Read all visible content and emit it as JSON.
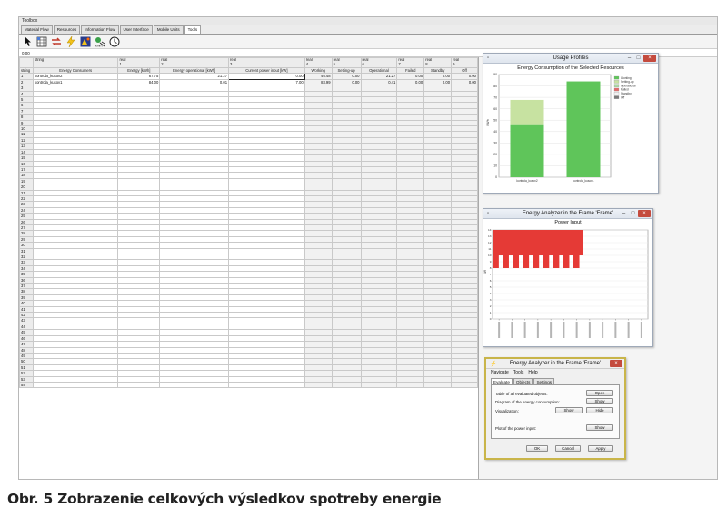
{
  "window": {
    "title": "Toolbox",
    "tabs": [
      "Material Flow",
      "Resources",
      "Information Flow",
      "User Interface",
      "Mobile Units",
      "Tools"
    ],
    "active_tab": 5
  },
  "toolbar": {
    "icons": [
      "pointer-icon",
      "sheet-icon",
      "exchange-icon",
      "lightning-icon",
      "analyzer-icon",
      "energy-icon",
      "clock-icon"
    ]
  },
  "sheet": {
    "cell_ref": "0.00",
    "type_row": [
      "",
      "string",
      "real\n1",
      "real\n2",
      "real\n3",
      "real\n4",
      "real\n5",
      "real\n6",
      "real\n7",
      "real\n8",
      "real\n9"
    ],
    "header_row": [
      "string",
      "Energy Consumers",
      "Energy [kWh]",
      "Energy operational [kWh]",
      "Current power input [kW]",
      "Working",
      "Setting-up",
      "Operational",
      "Failed",
      "Standby",
      "Off"
    ],
    "rows": [
      [
        "1",
        "kontrola_kusov2",
        "67.75",
        "21.27",
        "0.00",
        "46.48",
        "0.00",
        "21.27",
        "0.00",
        "0.00",
        "0.00"
      ],
      [
        "2",
        "kontrola_kusov1",
        "84.00",
        "0.01",
        "7.00",
        "83.99",
        "0.00",
        "0.41",
        "0.00",
        "0.00",
        "0.00"
      ]
    ],
    "row_count": 54
  },
  "usage_profiles": {
    "window_title": "Usage Profiles",
    "chart_title": "Energy Consumption of the Selected Resources"
  },
  "power_window": {
    "window_title": "Energy Analyzer in the Frame 'Frame'",
    "chart_title": "Power Input"
  },
  "analyzer_panel": {
    "window_title": "Energy Analyzer in the Frame 'Frame'",
    "menu": [
      "Navigate",
      "Tools",
      "Help"
    ],
    "tabs": [
      "Evaluate",
      "Objects",
      "Settings"
    ],
    "rows": {
      "table_label": "Table of all evaluated objects:",
      "diagram_label": "Diagram of the energy consumption:",
      "visualization_label": "Visualization:",
      "plot_label": "Plot of the power input:"
    },
    "buttons": {
      "open": "Open",
      "show_diagram": "Show",
      "show_visual": "Show",
      "hide": "Hide",
      "show_plot": "Show",
      "ok": "OK",
      "cancel": "Cancel",
      "apply": "Apply"
    }
  },
  "colors": {
    "working": "#5fc55a",
    "setting_up": "#c7e2a1",
    "power_bar": "#e53a36",
    "panel_border": "#c9b54a"
  },
  "chart_data": [
    {
      "type": "bar",
      "stacked": true,
      "legend_position": "top-right",
      "legend": [
        "Working",
        "Setting-up",
        "Operational",
        "Failed",
        "Standby",
        "Off"
      ],
      "categories": [
        "kontrola_kusov2",
        "kontrola_kusov1"
      ],
      "series": [
        {
          "name": "Working",
          "color": "#5fc55a",
          "values": [
            46.48,
            83.99
          ]
        },
        {
          "name": "Setting-up",
          "color": "#c7e2a1",
          "values": [
            21.27,
            0.0
          ]
        }
      ],
      "ylabel": "kWh",
      "ylim": [
        0,
        90
      ],
      "yticks": [
        0,
        10,
        20,
        30,
        40,
        50,
        60,
        70,
        80,
        90
      ],
      "grid": true
    },
    {
      "type": "area",
      "ylabel": "kW",
      "ylim": [
        0,
        14
      ],
      "yticks": [
        0,
        1,
        2,
        3,
        4,
        5,
        6,
        7,
        8,
        9,
        10,
        11,
        12,
        13,
        14
      ],
      "x_tick_count": 12,
      "x_range_shown": [
        0,
        7
      ],
      "baseline": 8,
      "top": 14,
      "pulses": 9,
      "color": "#e53a36",
      "grid": true
    }
  ]
}
